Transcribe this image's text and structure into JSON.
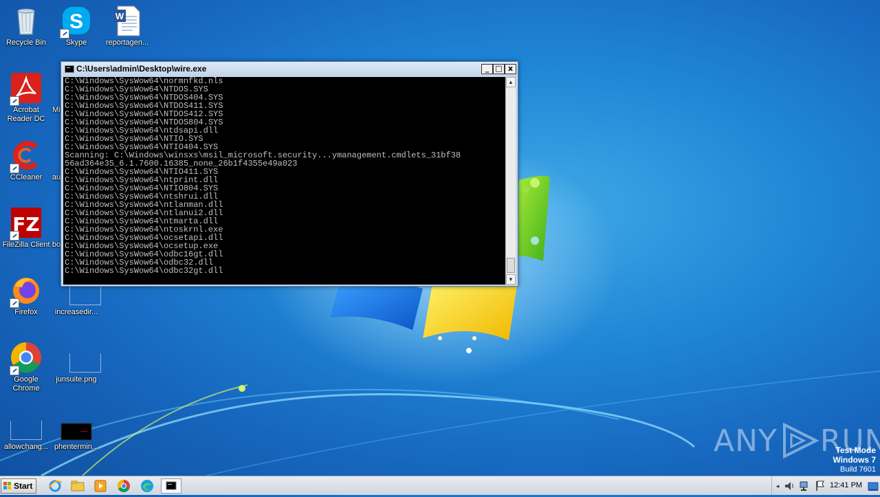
{
  "desktop": {
    "icons": [
      {
        "label": "Recycle Bin"
      },
      {
        "label": "Skype"
      },
      {
        "label": "reportagen..."
      },
      {
        "label": "Acrobat Reader DC"
      },
      {
        "label": "Mi"
      },
      {
        "label": "CCleaner"
      },
      {
        "label": "au"
      },
      {
        "label": "FileZilla Client"
      },
      {
        "label": "bo"
      },
      {
        "label": "Firefox"
      },
      {
        "label": "increasedir..."
      },
      {
        "label": "Google Chrome"
      },
      {
        "label": "junsuite.png"
      },
      {
        "label": "allowchang..."
      },
      {
        "label": "phentermin..."
      }
    ]
  },
  "window": {
    "title": "C:\\Users\\admin\\Desktop\\wire.exe",
    "minimize_glyph": "_",
    "maximize_glyph": "□",
    "close_glyph": "x",
    "console_lines": [
      "C:\\Windows\\SysWow64\\normnfkd.nls",
      "C:\\Windows\\SysWow64\\NTDOS.SYS",
      "C:\\Windows\\SysWow64\\NTDOS404.SYS",
      "C:\\Windows\\SysWow64\\NTDOS411.SYS",
      "C:\\Windows\\SysWow64\\NTDOS412.SYS",
      "C:\\Windows\\SysWow64\\NTDOS804.SYS",
      "C:\\Windows\\SysWow64\\ntdsapi.dll",
      "C:\\Windows\\SysWow64\\NTIO.SYS",
      "C:\\Windows\\SysWow64\\NTIO404.SYS",
      "Scanning: C:\\Windows\\winsxs\\msil_microsoft.security...ymanagement.cmdlets_31bf38",
      "56ad364e35_6.1.7600.16385_none_26b1f4355e49a023",
      "C:\\Windows\\SysWow64\\NTIO411.SYS",
      "C:\\Windows\\SysWow64\\ntprint.dll",
      "C:\\Windows\\SysWow64\\NTIO804.SYS",
      "C:\\Windows\\SysWow64\\ntshrui.dll",
      "C:\\Windows\\SysWow64\\ntlanman.dll",
      "C:\\Windows\\SysWow64\\ntlanui2.dll",
      "C:\\Windows\\SysWow64\\ntmarta.dll",
      "C:\\Windows\\SysWow64\\ntoskrnl.exe",
      "C:\\Windows\\SysWow64\\ocsetapi.dll",
      "C:\\Windows\\SysWow64\\ocsetup.exe",
      "C:\\Windows\\SysWow64\\odbc16gt.dll",
      "C:\\Windows\\SysWow64\\odbc32.dll",
      "C:\\Windows\\SysWow64\\odbc32gt.dll"
    ]
  },
  "watermark": {
    "brand": "ANY RUN",
    "brand_left": "ANY",
    "brand_right": "RUN",
    "test_mode": "Test Mode",
    "os": "Windows 7",
    "build": "Build 7601"
  },
  "taskbar": {
    "start_label": "Start",
    "clock": "12:41 PM",
    "pinned": [
      "ie-icon",
      "explorer-icon",
      "media-player-icon",
      "chrome-icon",
      "edge-icon",
      "console-app-icon"
    ]
  },
  "colors": {
    "accent": "#1f86d6",
    "console_bg": "#000000",
    "console_text": "#c0c0c0"
  }
}
